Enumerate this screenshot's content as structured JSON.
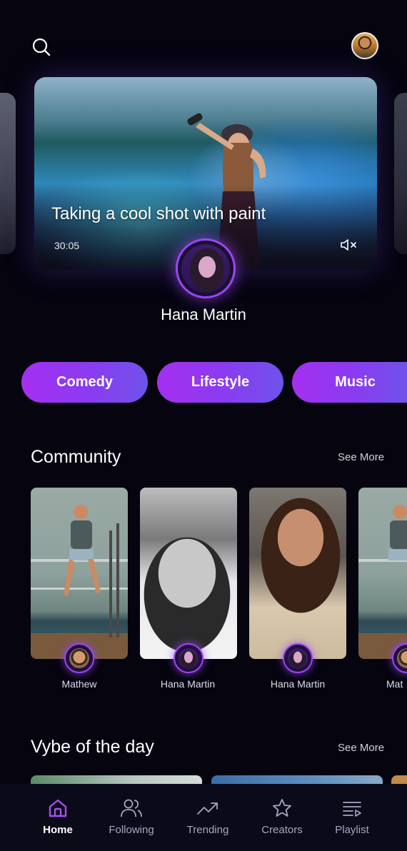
{
  "header": {
    "search_icon": "search-icon",
    "profile_icon": "profile-avatar"
  },
  "hero": {
    "title": "Taking a cool shot with paint",
    "duration": "30:05",
    "mute_icon": "mute-icon",
    "creator_name": "Hana Martin"
  },
  "categories": [
    {
      "label": "Comedy"
    },
    {
      "label": "Lifestyle"
    },
    {
      "label": "Music"
    }
  ],
  "community": {
    "title": "Community",
    "see_more": "See More",
    "items": [
      {
        "name": "Mathew"
      },
      {
        "name": "Hana Martin"
      },
      {
        "name": "Hana Martin"
      },
      {
        "name": "Mat"
      }
    ]
  },
  "vybe": {
    "title": "Vybe of the day",
    "see_more": "See More"
  },
  "nav": {
    "items": [
      {
        "label": "Home",
        "icon": "home-icon",
        "active": true
      },
      {
        "label": "Following",
        "icon": "following-icon",
        "active": false
      },
      {
        "label": "Trending",
        "icon": "trending-icon",
        "active": false
      },
      {
        "label": "Creators",
        "icon": "star-icon",
        "active": false
      },
      {
        "label": "Playlist",
        "icon": "playlist-icon",
        "active": false
      }
    ]
  },
  "colors": {
    "background": "#05040f",
    "accent": "#9b46f0",
    "active_nav": "#a84ef0",
    "chip_gradient_start": "#a52ff0",
    "chip_gradient_end": "#6f52ea"
  }
}
